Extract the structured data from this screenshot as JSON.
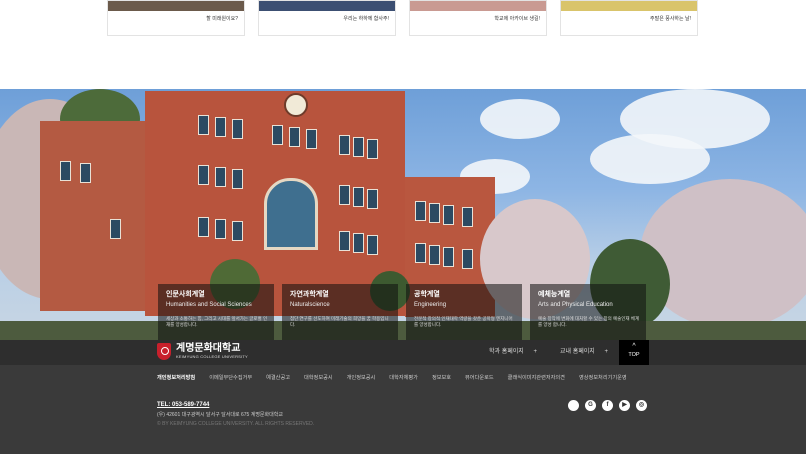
{
  "cards": [
    {
      "caption": "할 미래원이요?",
      "color": "#6b5a4b"
    },
    {
      "caption": "우리는 하하께 함사주!",
      "color": "#3c4f72"
    },
    {
      "caption": "학교에 아카이브 생길!",
      "color": "#c99a92"
    },
    {
      "caption": "주말은 풍사하는 날!",
      "color": "#d9c46b"
    }
  ],
  "colleges": [
    {
      "title": "인문사회계열",
      "english": "Humanities and Social Sciences",
      "desc": "세상과 소통하는 힘, 그리고 시대를 앞서가는 글로벌 인재를 양성합니다."
    },
    {
      "title": "자연과학계열",
      "english": "Naturalscience",
      "desc": "첨단 연구를 선도하여 미래기술의 희망을 꿈 학용입니다."
    },
    {
      "title": "공학계열",
      "english": "Engineering",
      "desc": "전문적 창의적 인재대학 역량을 갖춘 공학형 엔지니어를 양성합니다."
    },
    {
      "title": "예체능계열",
      "english": "Arts and Physical Education",
      "desc": "예술 창작에 변화에 대처할 수 있는 창의 예술인재 체계를 양성 합니다."
    }
  ],
  "footbar": {
    "logo_korean": "계명문화대학교",
    "logo_english": "KEIMYUNG COLLEGE UNIVERSITY",
    "dept_homepage": "학과 홈페이지",
    "campus_homepage": "교내 홈페이지",
    "plus": "+",
    "top_arrow": "^",
    "top_label": "TOP"
  },
  "footer_links": [
    "개인정보처리방침",
    "이메일무단수집거부",
    "예결산공고",
    "대학정보공시",
    "개인정보공시",
    "대학자체평가",
    "정보보호",
    "뷰어다운로드",
    "클래식이미지관련저자의견",
    "영상정보처리기기운영"
  ],
  "contact": {
    "tel": "TEL: 053-589-7744",
    "address": "(우) 42601 대구광역시 달서구 달서대로 675 계명문화대학교",
    "copyright": "© BY KEIMYUNG COLLEGE UNIVERSITY. ALL RIGHTS RESERVED."
  },
  "social_icons": [
    "apple-icon",
    "google-icon",
    "facebook-icon",
    "youtube-icon",
    "instagram-icon"
  ]
}
